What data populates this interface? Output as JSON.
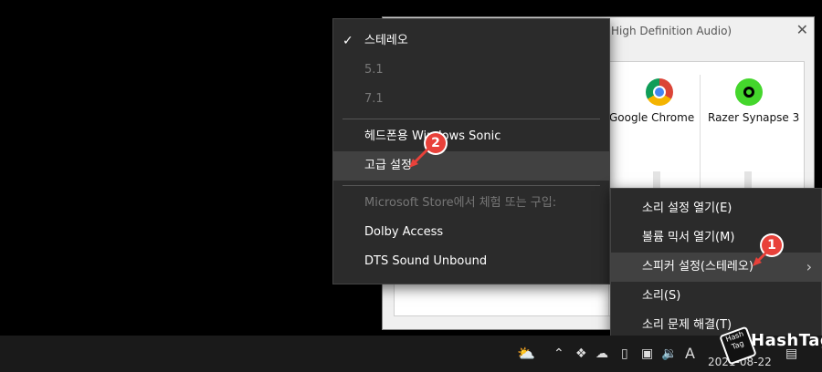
{
  "mixer": {
    "title": "High Definition Audio)",
    "apps": [
      {
        "name": "Google Chrome",
        "icon": "chrome-icon"
      },
      {
        "name": "Razer Synapse 3",
        "icon": "razer-icon"
      }
    ]
  },
  "format_menu": {
    "items": [
      {
        "label": "스테레오",
        "checked": true,
        "disabled": false
      },
      {
        "label": "5.1",
        "disabled": true
      },
      {
        "label": "7.1",
        "disabled": true
      },
      {
        "label": "헤드폰용 Windows Sonic"
      },
      {
        "label": "고급 설정",
        "highlighted": true
      },
      {
        "label": "Microsoft Store에서 체험 또는 구입:",
        "disabled": true
      },
      {
        "label": "Dolby Access"
      },
      {
        "label": "DTS Sound Unbound"
      }
    ]
  },
  "tray_menu": {
    "items": [
      {
        "label": "소리 설정 열기(E)"
      },
      {
        "label": "볼륨 믹서 열기(M)"
      },
      {
        "label": "스피커 설정(스테레오)",
        "highlighted": true,
        "submenu": true
      },
      {
        "label": "소리(S)"
      },
      {
        "label": "소리 문제 해결(T)"
      }
    ]
  },
  "badges": {
    "one": "1",
    "two": "2"
  },
  "taskbar": {
    "ime": "A",
    "date": "2021-08-22"
  },
  "watermark": {
    "text": "HashTag",
    "box_text": "Hash Tag"
  },
  "colors": {
    "badge": "#e8413a",
    "menu_bg": "#2b2b2b"
  }
}
